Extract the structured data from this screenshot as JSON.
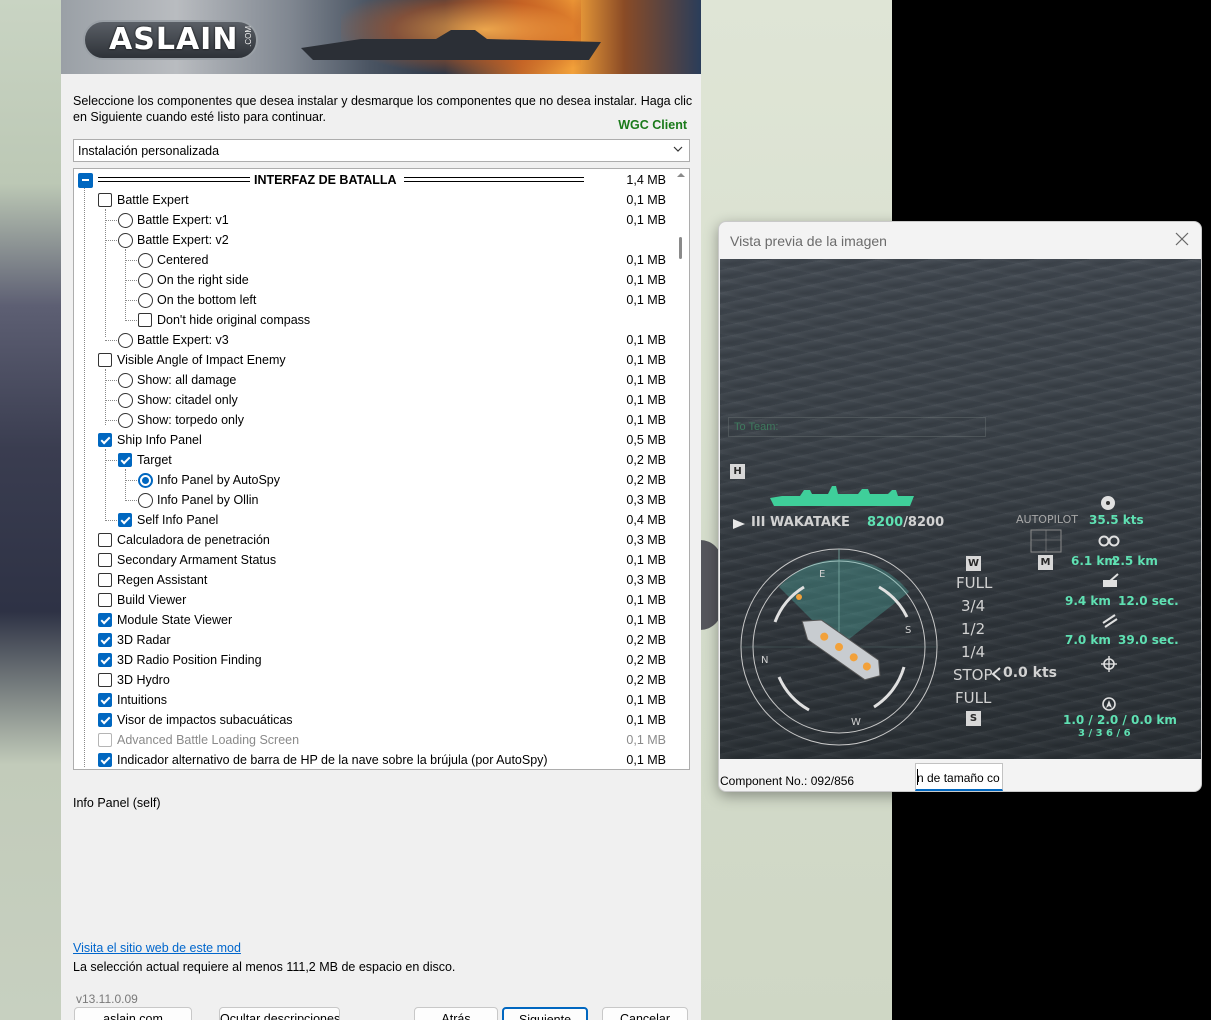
{
  "installer": {
    "banner_logo": "ASLAIN",
    "banner_logo_suffix": ".COM",
    "instructions": "Seleccione los componentes que desea instalar y desmarque los componentes que no desea instalar. Haga clic en Siguiente cuando esté listo para continuar.",
    "client_label": "WGC Client",
    "install_type": "Instalación personalizada",
    "components": [
      {
        "type": "group",
        "label": "INTERFAZ DE BATALLA",
        "size": "1,4 MB",
        "state": "partial"
      },
      {
        "type": "checkbox",
        "label": "Battle Expert",
        "size": "0,1 MB",
        "checked": false,
        "level": 1
      },
      {
        "type": "radio",
        "label": "Battle Expert: v1",
        "size": "0,1 MB",
        "checked": false,
        "level": 2
      },
      {
        "type": "radio",
        "label": "Battle Expert: v2",
        "size": "",
        "checked": false,
        "level": 2
      },
      {
        "type": "radio",
        "label": "Centered",
        "size": "0,1 MB",
        "checked": false,
        "level": 3
      },
      {
        "type": "radio",
        "label": "On the right side",
        "size": "0,1 MB",
        "checked": false,
        "level": 3
      },
      {
        "type": "radio",
        "label": "On the bottom left",
        "size": "0,1 MB",
        "checked": false,
        "level": 3
      },
      {
        "type": "checkbox",
        "label": "Don't hide original compass",
        "size": "",
        "checked": false,
        "level": 3
      },
      {
        "type": "radio",
        "label": "Battle Expert: v3",
        "size": "0,1 MB",
        "checked": false,
        "level": 2
      },
      {
        "type": "checkbox",
        "label": "Visible Angle of Impact Enemy",
        "size": "0,1 MB",
        "checked": false,
        "level": 1
      },
      {
        "type": "radio",
        "label": "Show: all damage",
        "size": "0,1 MB",
        "checked": false,
        "level": 2
      },
      {
        "type": "radio",
        "label": "Show: citadel only",
        "size": "0,1 MB",
        "checked": false,
        "level": 2
      },
      {
        "type": "radio",
        "label": "Show: torpedo only",
        "size": "0,1 MB",
        "checked": false,
        "level": 2
      },
      {
        "type": "checkbox",
        "label": "Ship Info Panel",
        "size": "0,5 MB",
        "checked": true,
        "level": 1
      },
      {
        "type": "checkbox",
        "label": "Target",
        "size": "0,2 MB",
        "checked": true,
        "level": 2
      },
      {
        "type": "radio",
        "label": "Info Panel by AutoSpy",
        "size": "0,2 MB",
        "checked": true,
        "level": 3
      },
      {
        "type": "radio",
        "label": "Info Panel by Ollin",
        "size": "0,3 MB",
        "checked": false,
        "level": 3
      },
      {
        "type": "checkbox",
        "label": "Self Info Panel",
        "size": "0,4 MB",
        "checked": true,
        "level": 2
      },
      {
        "type": "checkbox",
        "label": "Calculadora de penetración",
        "size": "0,3 MB",
        "checked": false,
        "level": 1
      },
      {
        "type": "checkbox",
        "label": "Secondary Armament Status",
        "size": "0,1 MB",
        "checked": false,
        "level": 1
      },
      {
        "type": "checkbox",
        "label": "Regen Assistant",
        "size": "0,3 MB",
        "checked": false,
        "level": 1
      },
      {
        "type": "checkbox",
        "label": "Build Viewer",
        "size": "0,1 MB",
        "checked": false,
        "level": 1
      },
      {
        "type": "checkbox",
        "label": "Module State Viewer",
        "size": "0,1 MB",
        "checked": true,
        "level": 1
      },
      {
        "type": "checkbox",
        "label": "3D Radar",
        "size": "0,2 MB",
        "checked": true,
        "level": 1
      },
      {
        "type": "checkbox",
        "label": "3D Radio Position Finding",
        "size": "0,2 MB",
        "checked": true,
        "level": 1
      },
      {
        "type": "checkbox",
        "label": "3D Hydro",
        "size": "0,2 MB",
        "checked": false,
        "level": 1
      },
      {
        "type": "checkbox",
        "label": "Intuitions",
        "size": "0,1 MB",
        "checked": true,
        "level": 1
      },
      {
        "type": "checkbox",
        "label": "Visor de impactos subacuáticas",
        "size": "0,1 MB",
        "checked": true,
        "level": 1
      },
      {
        "type": "checkbox",
        "label": "Advanced Battle Loading Screen",
        "size": "0,1 MB",
        "checked": false,
        "level": 1,
        "disabled": true
      },
      {
        "type": "checkbox",
        "label": "Indicador alternativo de barra de HP de la nave sobre la brújula (por AutoSpy)",
        "size": "0,1 MB",
        "checked": true,
        "level": 1
      }
    ],
    "description": "Info Panel (self)",
    "mod_link": "Visita el sitio web de este mod",
    "disk_requirement": "La selección actual requiere al menos 111,2 MB de espacio en disco.",
    "version": "v13.11.0.09",
    "buttons": {
      "site": "aslain.com",
      "hide_desc": "Ocultar descripciones",
      "back": "Atrás",
      "next": "Siguiente",
      "cancel": "Cancelar"
    }
  },
  "preview": {
    "title": "Vista previa de la imagen",
    "component_no": "Component No.: 092/856",
    "size_field_text": "n de tamaño co",
    "game": {
      "chat_label": "To Team:",
      "h_key": "H",
      "ship_name": "III WAKATAKE",
      "hp_current": "8200",
      "hp_max": "/8200",
      "compass_letters": [
        "E",
        "N",
        "W",
        "S"
      ],
      "throttle_keys": [
        "W",
        "S"
      ],
      "throttle_levels": [
        "FULL",
        "3/4",
        "1/2",
        "1/4",
        "STOP",
        "FULL"
      ],
      "speed_current": "0.0 kts",
      "autopilot": "AUTOPILOT",
      "autopilot_key": "M",
      "max_speed": "35.5 kts",
      "detect_ship": "6.1 km",
      "detect_air": "2.5 km",
      "main_range": "9.4 km",
      "main_reload": "12.0 sec.",
      "torp_range": "7.0 km",
      "torp_reload": "39.0 sec.",
      "consumables": "1.0 / 2.0 / 0.0 km",
      "consumable_counts": "3 / 3  6 / 6",
      "colors": {
        "hud_green": "#5fe0b2",
        "ship_green": "#3fcf9a"
      }
    }
  }
}
